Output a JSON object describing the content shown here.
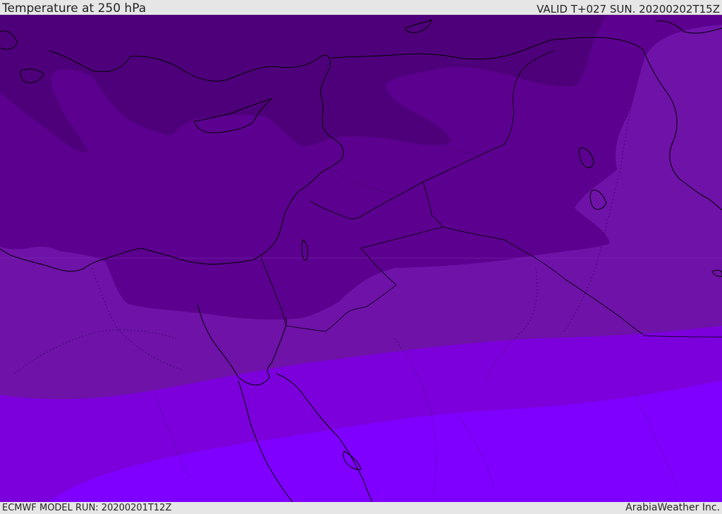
{
  "header": {
    "title": "Temperature at 250 hPa",
    "valid_time": "VALID T+027 SUN. 20200202T15Z"
  },
  "footer": {
    "model_run": "ECMWF MODEL RUN: 20200201T12Z",
    "credit": "ArabiaWeather Inc."
  },
  "colors": {
    "band_coldest": "#4e007a",
    "band_cold": "#5c008f",
    "band_mid": "#6e12a8",
    "band_warm": "#7b00dc",
    "band_warmest": "#7f00ff",
    "coastline": "#000000",
    "bar_background": "#e6e6e6"
  }
}
